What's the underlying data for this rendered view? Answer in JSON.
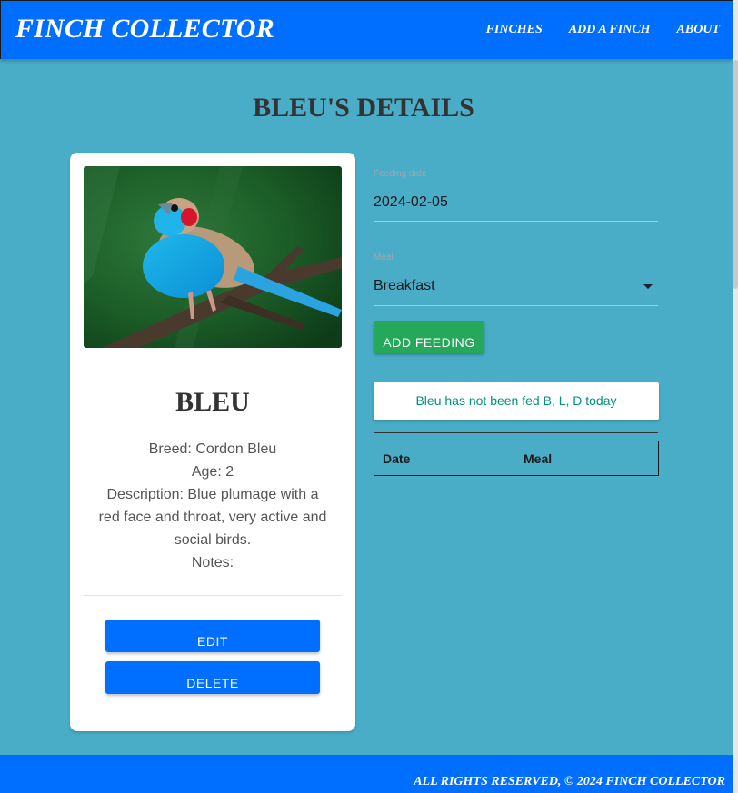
{
  "navbar": {
    "brand": "FINCH COLLECTOR",
    "links": [
      "FINCHES",
      "ADD A FINCH",
      "ABOUT"
    ]
  },
  "page": {
    "title": "BLEU'S DETAILS"
  },
  "card": {
    "name": "BLEU",
    "breed": "Breed: Cordon Bleu",
    "age": "Age: 2",
    "description": "Description: Blue plumage with a red face and throat, very active and social birds.",
    "notes": "Notes:",
    "edit_label": "EDIT",
    "delete_label": "DELETE"
  },
  "feeding_form": {
    "date_label": "Feeding date",
    "date_value": "2024-02-05",
    "meal_label": "Meal",
    "meal_value": "Breakfast",
    "submit_label": "ADD FEEDING"
  },
  "status": {
    "message": "Bleu has not been fed B, L, D today"
  },
  "feedings_table": {
    "headers": [
      "Date",
      "Meal"
    ],
    "rows": []
  },
  "footer": {
    "text": "ALL RIGHTS RESERVED, © 2024 FINCH COLLECTOR"
  },
  "colors": {
    "background": "#49adc8",
    "navbar": "#006eff",
    "button_blue": "#006eff",
    "button_green": "#26a85a",
    "status_text": "#00917a"
  }
}
